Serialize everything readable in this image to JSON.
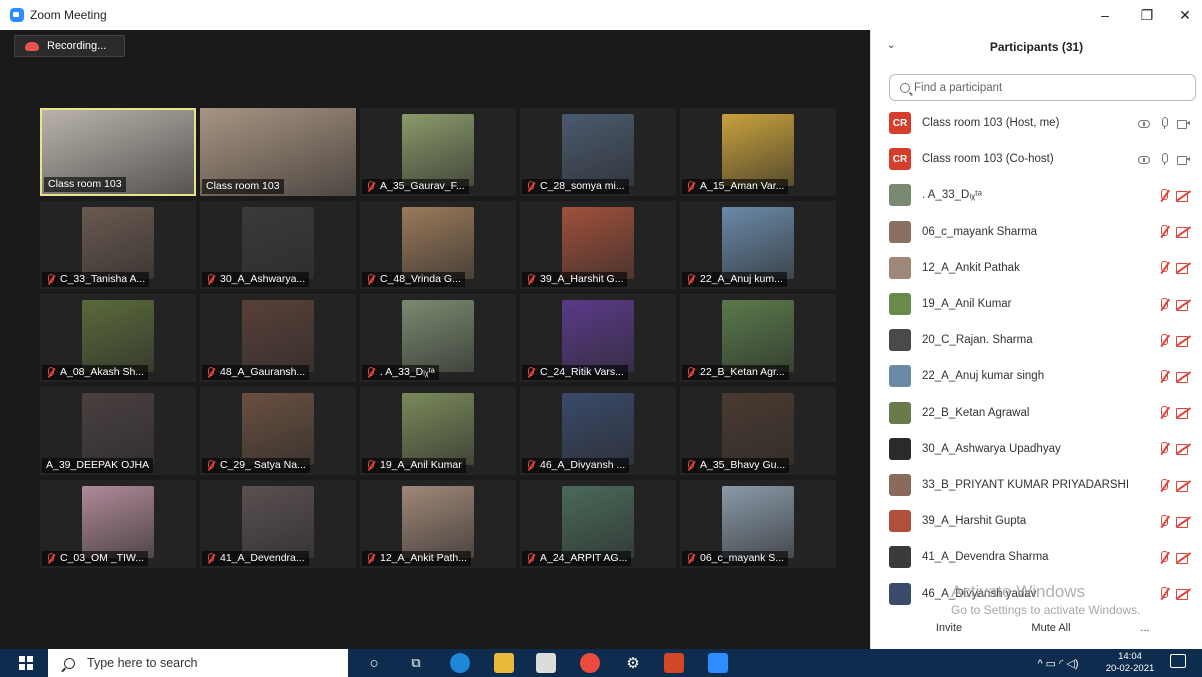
{
  "window": {
    "title": "Zoom Meeting",
    "minimize": "–",
    "restore": "❐",
    "close": "✕"
  },
  "recording": {
    "label": "Recording..."
  },
  "tiles": [
    {
      "name": "Class room 103",
      "muted": false,
      "active": true,
      "wide": true,
      "color": "#b9b3ab"
    },
    {
      "name": "Class room 103",
      "muted": false,
      "active": false,
      "wide": true,
      "color": "#a89482"
    },
    {
      "name": "A_35_Gaurav_F...",
      "muted": true,
      "color": "#8a9a6a"
    },
    {
      "name": "C_28_somya mi...",
      "muted": true,
      "color": "#4a5a6e"
    },
    {
      "name": "A_15_Aman Var...",
      "muted": true,
      "color": "#c9a23c"
    },
    {
      "name": "C_33_Tanisha A...",
      "muted": true,
      "color": "#6a5a50"
    },
    {
      "name": "30_A_Ashwarya...",
      "muted": true,
      "color": "#3a3a3a"
    },
    {
      "name": "C_48_Vrinda G...",
      "muted": true,
      "color": "#9a7a5a"
    },
    {
      "name": "39_A_Harshit G...",
      "muted": true,
      "color": "#a0503a"
    },
    {
      "name": "22_A_Anuj kum...",
      "muted": true,
      "color": "#6a8aa8"
    },
    {
      "name": "A_08_Akash Sh...",
      "muted": true,
      "color": "#5a6a3a"
    },
    {
      "name": "48_A_Gauransh...",
      "muted": true,
      "color": "#5a4038"
    },
    {
      "name": ". A_33_Dᵢᵪᵗᵃ",
      "muted": true,
      "color": "#7a8a70"
    },
    {
      "name": "C_24_Ritik Vars...",
      "muted": true,
      "color": "#5a3a8a"
    },
    {
      "name": "22_B_Ketan Agr...",
      "muted": true,
      "color": "#5a7a4a"
    },
    {
      "name": "A_39_DEEPAK OJHA",
      "muted": false,
      "color": "#4a4040"
    },
    {
      "name": "C_29_ Satya Na...",
      "muted": true,
      "color": "#6a5040"
    },
    {
      "name": "19_A_Anil Kumar",
      "muted": true,
      "color": "#7a8a5a"
    },
    {
      "name": "46_A_Divyansh ...",
      "muted": true,
      "color": "#3a4a6a"
    },
    {
      "name": "A_35_Bhavy Gu...",
      "muted": true,
      "color": "#4a3a30"
    },
    {
      "name": "C_03_OM _TIW...",
      "muted": true,
      "color": "#b08a9a"
    },
    {
      "name": "41_A_Devendra...",
      "muted": true,
      "color": "#5a5050"
    },
    {
      "name": "12_A_Ankit Path...",
      "muted": true,
      "color": "#a08878"
    },
    {
      "name": "A_24_ARPIT AG...",
      "muted": true,
      "color": "#4a6a5a"
    },
    {
      "name": "06_c_mayank S...",
      "muted": true,
      "color": "#8a9aa8"
    }
  ],
  "panel": {
    "title": "Participants (31)",
    "search_placeholder": "Find a participant",
    "participants": [
      {
        "name": "Class room 103 (Host, me)",
        "initials": "CR",
        "host": true
      },
      {
        "name": "Class room 103 (Co-host)",
        "initials": "CR",
        "host": true
      },
      {
        "name": ". A_33_Dᵢᵪᵗᵃ",
        "color": "#7a8a70"
      },
      {
        "name": "06_c_mayank Sharma",
        "color": "#8a7060"
      },
      {
        "name": "12_A_Ankit Pathak",
        "color": "#a08878"
      },
      {
        "name": "19_A_Anil Kumar",
        "color": "#6a8a4a"
      },
      {
        "name": "20_C_Rajan. Sharma",
        "color": "#4a4a4a"
      },
      {
        "name": "22_A_Anuj kumar singh",
        "color": "#6a8aa8"
      },
      {
        "name": "22_B_Ketan Agrawal",
        "color": "#6a7a4a"
      },
      {
        "name": "30_A_Ashwarya Upadhyay",
        "color": "#2a2a2a"
      },
      {
        "name": "33_B_PRIYANT KUMAR PRIYADARSHI",
        "color": "#8a6a5a"
      },
      {
        "name": "39_A_Harshit Gupta",
        "color": "#b0503a"
      },
      {
        "name": "41_A_Devendra Sharma",
        "color": "#3a3a3a"
      },
      {
        "name": "46_A_Divyansh yadav",
        "color": "#3a4a6a"
      }
    ],
    "invite_label": "Invite",
    "mute_all_label": "Mute All",
    "more_label": "..."
  },
  "watermark": {
    "line1": "Activate Windows",
    "line2": "Go to Settings to activate Windows."
  },
  "taskbar": {
    "search_placeholder": "Type here to search",
    "time": "14:04",
    "date": "20-02-2021",
    "tray": "^ ▭ ◜ ◁)"
  },
  "colors": {
    "accent": "#2d8cff",
    "muted_red": "#e0433a",
    "taskbar": "#0e2c4d"
  }
}
